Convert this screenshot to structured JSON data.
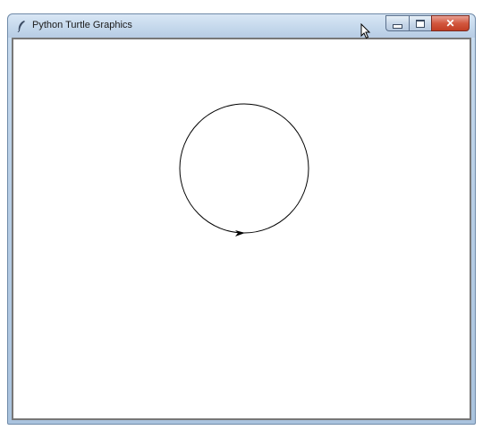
{
  "window": {
    "title": "Python Turtle Graphics",
    "app_icon": "feather-icon",
    "controls": {
      "minimize_icon": "minimize-icon",
      "maximize_icon": "maximize-icon",
      "close_icon": "close-icon",
      "close_glyph": "✕"
    }
  },
  "canvas": {
    "background": "#ffffff",
    "drawing": {
      "shape": "circle",
      "stroke_color": "#000000",
      "turtle_icon": "arrow-turtle-icon",
      "turtle_heading": "east"
    }
  },
  "cursor_icon": "mouse-pointer-icon"
}
